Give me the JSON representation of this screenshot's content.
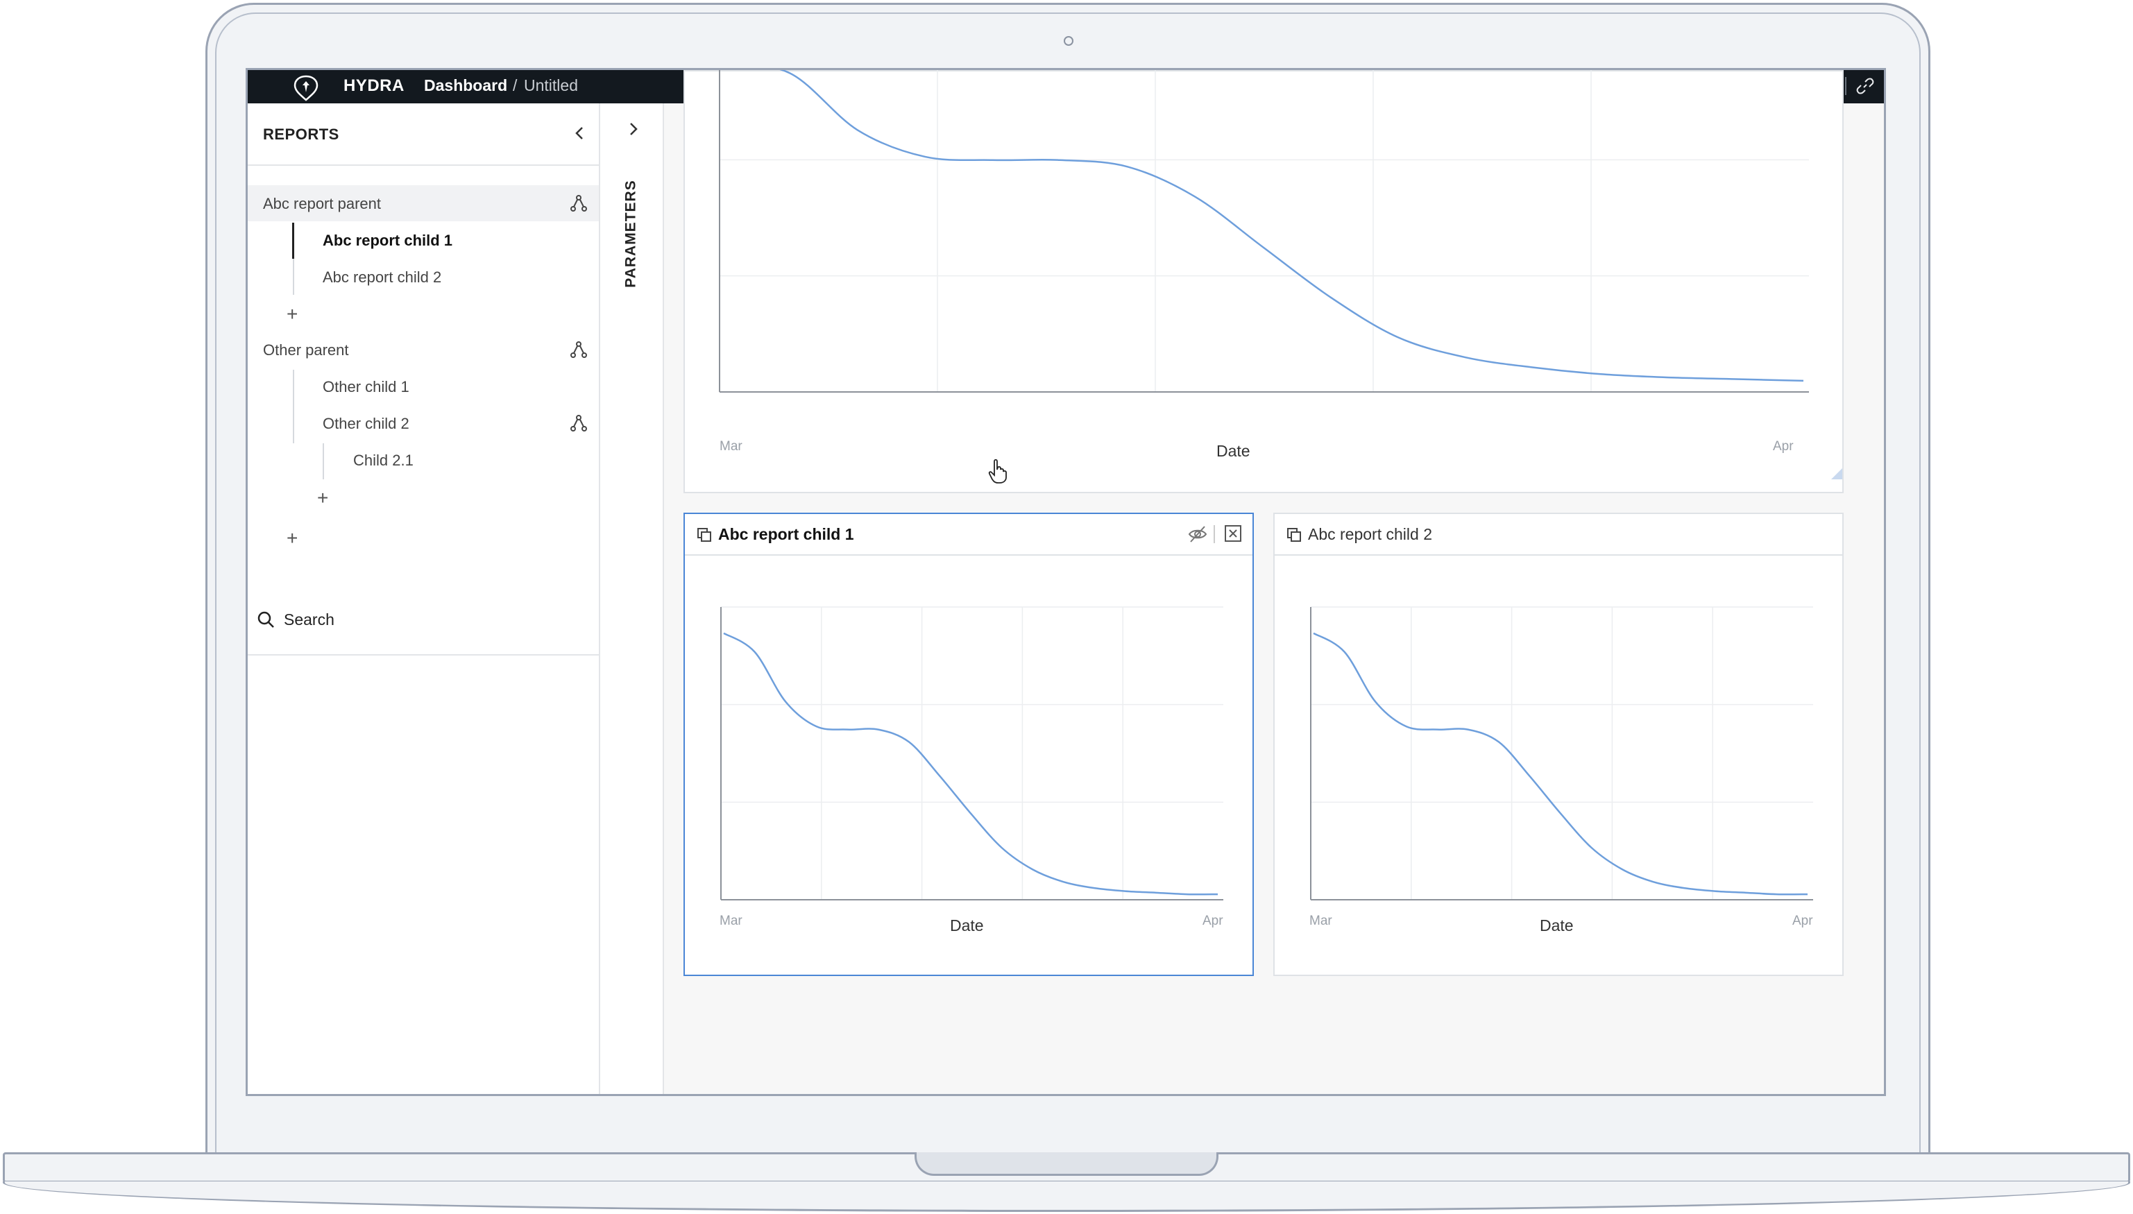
{
  "app": {
    "brand": "HYDRA",
    "breadcrumb_main": "Dashboard",
    "breadcrumb_sep": "/",
    "breadcrumb_sub": "Untitled"
  },
  "toolbar_icons": [
    "alert-icon",
    "link-icon"
  ],
  "sidebar": {
    "title": "REPORTS",
    "groups": [
      {
        "label": "Abc report parent",
        "children": [
          "Abc report child 1",
          "Abc report child 2"
        ]
      },
      {
        "label": "Other parent",
        "children": [
          "Other child 1",
          "Other child 2"
        ],
        "grandchildren": [
          "Child 2.1"
        ]
      }
    ],
    "add_symbol": "+",
    "search_label": "Search"
  },
  "params": {
    "label": "PARAMETERS"
  },
  "panels": {
    "top": {
      "title": "",
      "xlabel": "Date",
      "x_start": "Mar",
      "x_end": "Apr"
    },
    "child1": {
      "title": "Abc report child 1",
      "xlabel": "Date",
      "x_start": "Mar",
      "x_end": "Apr"
    },
    "child2": {
      "title": "Abc report child 2",
      "xlabel": "Date",
      "x_start": "Mar",
      "x_end": "Apr"
    }
  },
  "colors": {
    "accent": "#4a86d6",
    "line": "#6e9fdc",
    "topbar": "#13191f"
  },
  "chart_data": [
    {
      "type": "line",
      "title": "",
      "xlabel": "Date",
      "ylabel": "",
      "x_ticks": [
        "Mar",
        "Apr"
      ],
      "grid": true,
      "series": [
        {
          "values": [
            1.0,
            0.97,
            0.8,
            0.72,
            0.71,
            0.71,
            0.69,
            0.6,
            0.45,
            0.3,
            0.18,
            0.12,
            0.09,
            0.07,
            0.06,
            0.055,
            0.05
          ]
        }
      ]
    },
    {
      "type": "line",
      "title": "Abc report child 1",
      "xlabel": "Date",
      "ylabel": "",
      "x_ticks": [
        "Mar",
        "Apr"
      ],
      "grid": true,
      "series": [
        {
          "values": [
            0.88,
            0.82,
            0.66,
            0.58,
            0.57,
            0.57,
            0.53,
            0.42,
            0.3,
            0.19,
            0.12,
            0.08,
            0.06,
            0.05,
            0.045,
            0.04,
            0.04
          ]
        }
      ]
    },
    {
      "type": "line",
      "title": "Abc report child 2",
      "xlabel": "Date",
      "ylabel": "",
      "x_ticks": [
        "Mar",
        "Apr"
      ],
      "grid": true,
      "series": [
        {
          "values": [
            0.88,
            0.82,
            0.66,
            0.58,
            0.57,
            0.57,
            0.53,
            0.42,
            0.3,
            0.19,
            0.12,
            0.08,
            0.06,
            0.05,
            0.045,
            0.04,
            0.04
          ]
        }
      ]
    }
  ]
}
